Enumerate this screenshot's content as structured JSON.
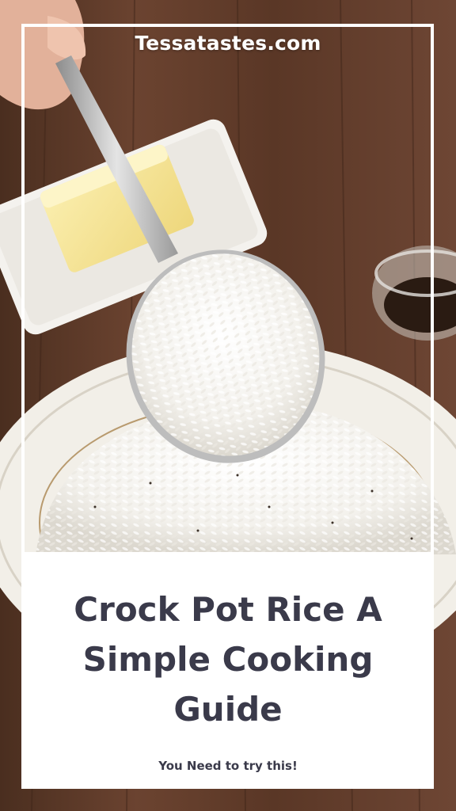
{
  "brand": {
    "site_name": "Tessatastes.com"
  },
  "pin": {
    "title_lines": [
      "Crock Pot Rice A",
      "Simple Cooking",
      "Guide"
    ],
    "subtitle": "You Need to try this!"
  },
  "colors": {
    "title_text": "#3a3a4a",
    "frame": "#ffffff",
    "table_wood": "#5a3a27"
  }
}
